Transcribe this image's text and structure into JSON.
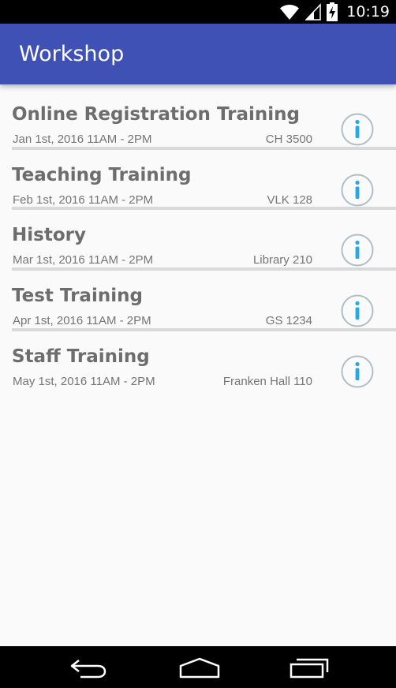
{
  "status_bar": {
    "time": "10:19",
    "icons": [
      "wifi-icon",
      "signal-icon",
      "battery-charging-icon"
    ]
  },
  "app_bar": {
    "title": "Workshop"
  },
  "workshops": [
    {
      "title": "Online Registration Training",
      "date": "Jan 1st, 2016 11AM - 2PM",
      "location": "CH 3500"
    },
    {
      "title": "Teaching Training",
      "date": "Feb 1st, 2016 11AM - 2PM",
      "location": "VLK 128"
    },
    {
      "title": "History",
      "date": "Mar 1st, 2016 11AM - 2PM",
      "location": "Library 210"
    },
    {
      "title": "Test Training",
      "date": "Apr 1st, 2016 11AM - 2PM",
      "location": "GS 1234"
    },
    {
      "title": "Staff Training",
      "date": "May 1st, 2016 11AM - 2PM",
      "location": "Franken Hall 110"
    }
  ],
  "nav_bar": {
    "icons": [
      "back-icon",
      "home-icon",
      "recents-icon"
    ]
  },
  "colors": {
    "primary": "#3f51b5",
    "info_icon": "#29a8e8",
    "info_ring": "#b0bec5",
    "text": "#6d6d6d"
  }
}
